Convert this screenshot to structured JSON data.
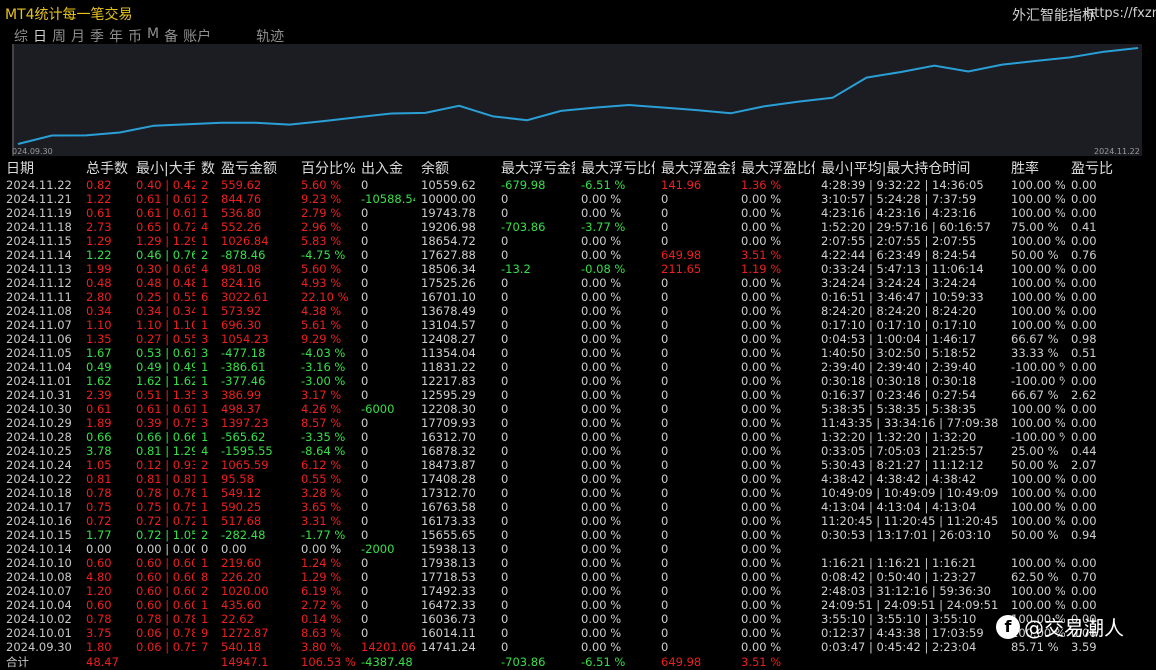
{
  "app": {
    "title": "MT4统计每一笔交易",
    "brand": "外汇智能指标",
    "url": "https://fxznzb"
  },
  "tabs": [
    "综",
    "日",
    "周",
    "月",
    "季",
    "年",
    "币",
    "M",
    "备",
    "账户",
    "轨迹"
  ],
  "active_tab": "日",
  "chart_data": {
    "type": "line",
    "x_start_label": "024.09.30",
    "x_end_label": "2024.11.22",
    "color": "#2a9fd6",
    "x": [
      "2024.09.30",
      "2024.10.01",
      "2024.10.02",
      "2024.10.04",
      "2024.10.07",
      "2024.10.08",
      "2024.10.10",
      "2024.10.14",
      "2024.10.15",
      "2024.10.16",
      "2024.10.17",
      "2024.10.18",
      "2024.10.22",
      "2024.10.24",
      "2024.10.25",
      "2024.10.28",
      "2024.10.29",
      "2024.10.30",
      "2024.10.31",
      "2024.11.01",
      "2024.11.04",
      "2024.11.05",
      "2024.11.06",
      "2024.11.07",
      "2024.11.08",
      "2024.11.11",
      "2024.11.12",
      "2024.11.13",
      "2024.11.14",
      "2024.11.15",
      "2024.11.18",
      "2024.11.19",
      "2024.11.21",
      "2024.11.22"
    ],
    "values": [
      14741.24,
      16014.11,
      16036.73,
      16472.33,
      17492.33,
      17718.53,
      17938.13,
      15938.13,
      15655.65,
      16173.33,
      16763.58,
      17312.7,
      17408.28,
      18473.87,
      16878.32,
      16312.7,
      17709.93,
      12208.3,
      12595.29,
      12217.83,
      11831.22,
      11354.04,
      12408.27,
      13104.57,
      13678.49,
      16701.1,
      17525.26,
      18506.34,
      17627.88,
      18654.72,
      19206.98,
      19743.78,
      10000.0,
      10559.62
    ],
    "plot_values": [
      14741.24,
      16014.11,
      16036.73,
      16472.33,
      17492.33,
      17718.53,
      17938.13,
      17938.13,
      17655.65,
      18173.33,
      18763.58,
      19312.7,
      19408.28,
      20473.87,
      18878.32,
      18312.7,
      19709.93,
      20208.3,
      20595.29,
      20217.83,
      19831.22,
      19354.04,
      20408.27,
      21104.57,
      21678.49,
      24701.1,
      25525.26,
      26506.34,
      25627.88,
      26654.72,
      27206.98,
      27743.78,
      28588.4,
      29148.0
    ]
  },
  "columns": [
    "日期",
    "总手数",
    "最小|大手数",
    "数",
    "盈亏金额",
    "百分比%",
    "出入金",
    "余额",
    "最大浮亏金额",
    "最大浮亏比例",
    "最大浮盈金额",
    "最大浮盈比例",
    "最小|平均|最大持仓时间",
    "胜率",
    "盈亏比"
  ],
  "rows": [
    [
      "2024.11.22",
      "0.82",
      "0.40 | 0.42",
      "2",
      "559.62",
      "5.60 %",
      "0",
      "10559.62",
      "-679.98",
      "-6.51 %",
      "141.96",
      "1.36 %",
      "4:28:39 | 9:32:22 | 14:36:05",
      "100.00 %",
      "0.00"
    ],
    [
      "2024.11.21",
      "1.22",
      "0.61 | 0.61",
      "2",
      "844.76",
      "9.23 %",
      "-10588.54",
      "10000.00",
      "0",
      "0.00 %",
      "0",
      "0.00 %",
      "3:10:57 | 5:24:28 | 7:37:59",
      "100.00 %",
      "0.00"
    ],
    [
      "2024.11.19",
      "0.61",
      "0.61 | 0.61",
      "1",
      "536.80",
      "2.79 %",
      "0",
      "19743.78",
      "0",
      "0.00 %",
      "0",
      "0.00 %",
      "4:23:16 | 4:23:16 | 4:23:16",
      "100.00 %",
      "0.00"
    ],
    [
      "2024.11.18",
      "2.73",
      "0.65 | 0.72",
      "4",
      "552.26",
      "2.96 %",
      "0",
      "19206.98",
      "-703.86",
      "-3.77 %",
      "0",
      "0.00 %",
      "1:52:20 | 29:57:16 | 60:16:57",
      "75.00 %",
      "0.41"
    ],
    [
      "2024.11.15",
      "1.29",
      "1.29 | 1.29",
      "1",
      "1026.84",
      "5.83 %",
      "0",
      "18654.72",
      "0",
      "0.00 %",
      "0",
      "0.00 %",
      "2:07:55 | 2:07:55 | 2:07:55",
      "100.00 %",
      "0.00"
    ],
    [
      "2024.11.14",
      "1.22",
      "0.46 | 0.76",
      "2",
      "-878.46",
      "-4.75 %",
      "0",
      "17627.88",
      "0",
      "0.00 %",
      "649.98",
      "3.51 %",
      "4:22:44 | 6:23:49 | 8:24:54",
      "50.00 %",
      "0.76"
    ],
    [
      "2024.11.13",
      "1.99",
      "0.30 | 0.65",
      "4",
      "981.08",
      "5.60 %",
      "0",
      "18506.34",
      "-13.2",
      "-0.08 %",
      "211.65",
      "1.19 %",
      "0:33:24 | 5:47:13 | 11:06:14",
      "100.00 %",
      "0.00"
    ],
    [
      "2024.11.12",
      "0.48",
      "0.48 | 0.48",
      "1",
      "824.16",
      "4.93 %",
      "0",
      "17525.26",
      "0",
      "0.00 %",
      "0",
      "0.00 %",
      "3:24:24 | 3:24:24 | 3:24:24",
      "100.00 %",
      "0.00"
    ],
    [
      "2024.11.11",
      "2.80",
      "0.25 | 0.55",
      "6",
      "3022.61",
      "22.10 %",
      "0",
      "16701.10",
      "0",
      "0.00 %",
      "0",
      "0.00 %",
      "0:16:51 | 3:46:47 | 10:59:33",
      "100.00 %",
      "0.00"
    ],
    [
      "2024.11.08",
      "0.34",
      "0.34 | 0.34",
      "1",
      "573.92",
      "4.38 %",
      "0",
      "13678.49",
      "0",
      "0.00 %",
      "0",
      "0.00 %",
      "8:24:20 | 8:24:20 | 8:24:20",
      "100.00 %",
      "0.00"
    ],
    [
      "2024.11.07",
      "1.10",
      "1.10 | 1.10",
      "1",
      "696.30",
      "5.61 %",
      "0",
      "13104.57",
      "0",
      "0.00 %",
      "0",
      "0.00 %",
      "0:17:10 | 0:17:10 | 0:17:10",
      "100.00 %",
      "0.00"
    ],
    [
      "2024.11.06",
      "1.35",
      "0.27 | 0.55",
      "3",
      "1054.23",
      "9.29 %",
      "0",
      "12408.27",
      "0",
      "0.00 %",
      "0",
      "0.00 %",
      "0:04:53 | 1:00:04 | 1:46:17",
      "66.67 %",
      "0.98"
    ],
    [
      "2024.11.05",
      "1.67",
      "0.53 | 0.61",
      "3",
      "-477.18",
      "-4.03 %",
      "0",
      "11354.04",
      "0",
      "0.00 %",
      "0",
      "0.00 %",
      "1:40:50 | 3:02:50 | 5:18:52",
      "33.33 %",
      "0.51"
    ],
    [
      "2024.11.04",
      "0.49",
      "0.49 | 0.49",
      "1",
      "-386.61",
      "-3.16 %",
      "0",
      "11831.22",
      "0",
      "0.00 %",
      "0",
      "0.00 %",
      "2:39:40 | 2:39:40 | 2:39:40",
      "-100.00 %",
      "0.00"
    ],
    [
      "2024.11.01",
      "1.62",
      "1.62 | 1.62",
      "1",
      "-377.46",
      "-3.00 %",
      "0",
      "12217.83",
      "0",
      "0.00 %",
      "0",
      "0.00 %",
      "0:30:18 | 0:30:18 | 0:30:18",
      "-100.00 %",
      "0.00"
    ],
    [
      "2024.10.31",
      "2.39",
      "0.51 | 1.35",
      "3",
      "386.99",
      "3.17 %",
      "0",
      "12595.29",
      "0",
      "0.00 %",
      "0",
      "0.00 %",
      "0:16:37 | 0:23:46 | 0:27:54",
      "66.67 %",
      "2.62"
    ],
    [
      "2024.10.30",
      "0.61",
      "0.61 | 0.61",
      "1",
      "498.37",
      "4.26 %",
      "-6000",
      "12208.30",
      "0",
      "0.00 %",
      "0",
      "0.00 %",
      "5:38:35 | 5:38:35 | 5:38:35",
      "100.00 %",
      "0.00"
    ],
    [
      "2024.10.29",
      "1.89",
      "0.39 | 0.75",
      "3",
      "1397.23",
      "8.57 %",
      "0",
      "17709.93",
      "0",
      "0.00 %",
      "0",
      "0.00 %",
      "11:43:35 | 33:34:16 | 77:09:38",
      "100.00 %",
      "0.00"
    ],
    [
      "2024.10.28",
      "0.66",
      "0.66 | 0.66",
      "1",
      "-565.62",
      "-3.35 %",
      "0",
      "16312.70",
      "0",
      "0.00 %",
      "0",
      "0.00 %",
      "1:32:20 | 1:32:20 | 1:32:20",
      "-100.00 %",
      "0.00"
    ],
    [
      "2024.10.25",
      "3.78",
      "0.81 | 1.29",
      "4",
      "-1595.55",
      "-8.64 %",
      "0",
      "16878.32",
      "0",
      "0.00 %",
      "0",
      "0.00 %",
      "0:33:05 | 7:05:03 | 21:25:57",
      "25.00 %",
      "0.44"
    ],
    [
      "2024.10.24",
      "1.05",
      "0.12 | 0.93",
      "2",
      "1065.59",
      "6.12 %",
      "0",
      "18473.87",
      "0",
      "0.00 %",
      "0",
      "0.00 %",
      "5:30:43 | 8:21:27 | 11:12:12",
      "50.00 %",
      "2.07"
    ],
    [
      "2024.10.22",
      "0.81",
      "0.81 | 0.81",
      "1",
      "95.58",
      "0.55 %",
      "0",
      "17408.28",
      "0",
      "0.00 %",
      "0",
      "0.00 %",
      "4:38:42 | 4:38:42 | 4:38:42",
      "100.00 %",
      "0.00"
    ],
    [
      "2024.10.18",
      "0.78",
      "0.78 | 0.78",
      "1",
      "549.12",
      "3.28 %",
      "0",
      "17312.70",
      "0",
      "0.00 %",
      "0",
      "0.00 %",
      "10:49:09 | 10:49:09 | 10:49:09",
      "100.00 %",
      "0.00"
    ],
    [
      "2024.10.17",
      "0.75",
      "0.75 | 0.75",
      "1",
      "590.25",
      "3.65 %",
      "0",
      "16763.58",
      "0",
      "0.00 %",
      "0",
      "0.00 %",
      "4:13:04 | 4:13:04 | 4:13:04",
      "100.00 %",
      "0.00"
    ],
    [
      "2024.10.16",
      "0.72",
      "0.72 | 0.72",
      "1",
      "517.68",
      "3.31 %",
      "0",
      "16173.33",
      "0",
      "0.00 %",
      "0",
      "0.00 %",
      "11:20:45 | 11:20:45 | 11:20:45",
      "100.00 %",
      "0.00"
    ],
    [
      "2024.10.15",
      "1.77",
      "0.72 | 1.05",
      "2",
      "-282.48",
      "-1.77 %",
      "0",
      "15655.65",
      "0",
      "0.00 %",
      "0",
      "0.00 %",
      "0:30:53 | 13:17:01 | 26:03:10",
      "50.00 %",
      "0.94"
    ],
    [
      "2024.10.14",
      "0.00",
      "0.00 | 0.00",
      "0",
      "0.00",
      "0.00 %",
      "-2000",
      "15938.13",
      "0",
      "0.00 %",
      "0",
      "0.00 %",
      "",
      "",
      ""
    ],
    [
      "2024.10.10",
      "0.60",
      "0.60 | 0.60",
      "1",
      "219.60",
      "1.24 %",
      "0",
      "17938.13",
      "0",
      "0.00 %",
      "0",
      "0.00 %",
      "1:16:21 | 1:16:21 | 1:16:21",
      "100.00 %",
      "0.00"
    ],
    [
      "2024.10.08",
      "4.80",
      "0.60 | 0.60",
      "8",
      "226.20",
      "1.29 %",
      "0",
      "17718.53",
      "0",
      "0.00 %",
      "0",
      "0.00 %",
      "0:08:42 | 0:50:40 | 1:23:27",
      "62.50 %",
      "0.70"
    ],
    [
      "2024.10.07",
      "1.20",
      "0.60 | 0.60",
      "2",
      "1020.00",
      "6.19 %",
      "0",
      "17492.33",
      "0",
      "0.00 %",
      "0",
      "0.00 %",
      "2:48:03 | 31:12:16 | 59:36:30",
      "100.00 %",
      "0.00"
    ],
    [
      "2024.10.04",
      "0.60",
      "0.60 | 0.60",
      "1",
      "435.60",
      "2.72 %",
      "0",
      "16472.33",
      "0",
      "0.00 %",
      "0",
      "0.00 %",
      "24:09:51 | 24:09:51 | 24:09:51",
      "100.00 %",
      "0.00"
    ],
    [
      "2024.10.02",
      "0.78",
      "0.78 | 0.78",
      "1",
      "22.62",
      "0.14 %",
      "0",
      "16036.73",
      "0",
      "0.00 %",
      "0",
      "0.00 %",
      "3:55:10 | 3:55:10 | 3:55:10",
      "100.00 %",
      "0.00"
    ],
    [
      "2024.10.01",
      "3.75",
      "0.06 | 0.78",
      "9",
      "1272.87",
      "8.63 %",
      "0",
      "16014.11",
      "0",
      "0.00 %",
      "0",
      "0.00 %",
      "0:12:37 | 4:43:38 | 17:03:59",
      "100.00 %",
      "0.00"
    ],
    [
      "2024.09.30",
      "1.80",
      "0.06 | 0.75",
      "7",
      "540.18",
      "3.80 %",
      "14201.06",
      "14741.24",
      "0",
      "0.00 %",
      "0",
      "0.00 %",
      "0:03:47 | 0:45:42 | 2:23:04",
      "85.71 %",
      "3.59"
    ]
  ],
  "total": [
    "合计",
    "48.47",
    "",
    "",
    "14947.1",
    "106.53 %",
    "-4387.48",
    "",
    "-703.86",
    "-6.51 %",
    "649.98",
    "3.51 %",
    "",
    "",
    ""
  ],
  "colors": {
    "positive": "#36e048",
    "negative": "#ee1f1f",
    "line": "#2a9fd6",
    "title": "#e6c21c"
  },
  "watermark": {
    "icon": "facebook-icon",
    "text": "@交易潮人"
  }
}
